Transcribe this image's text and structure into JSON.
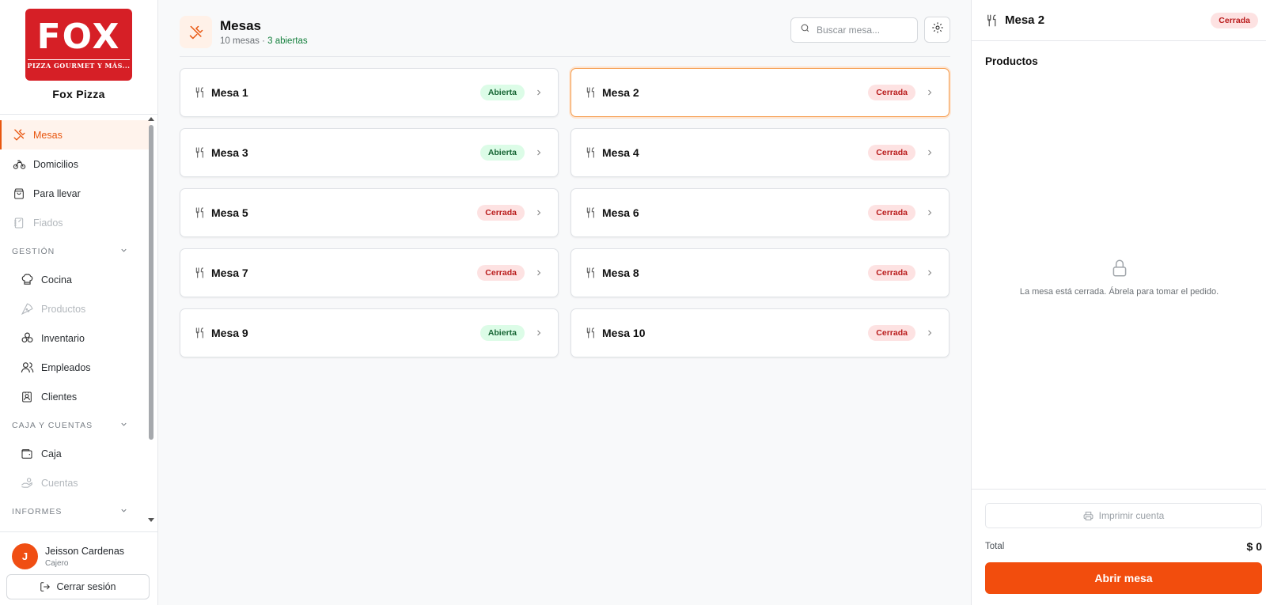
{
  "brand": {
    "logo_main": "FOX",
    "logo_sub": "PIZZA GOURMET Y MÁS...",
    "name": "Fox Pizza"
  },
  "sidebar": {
    "items": [
      {
        "label": "Mesas"
      },
      {
        "label": "Domicilios"
      },
      {
        "label": "Para llevar"
      },
      {
        "label": "Fiados"
      }
    ],
    "sections": [
      {
        "label": "GESTIÓN",
        "items": [
          "Cocina",
          "Productos",
          "Inventario",
          "Empleados",
          "Clientes"
        ]
      },
      {
        "label": "CAJA Y CUENTAS",
        "items": [
          "Caja",
          "Cuentas"
        ]
      },
      {
        "label": "INFORMES"
      }
    ]
  },
  "user": {
    "initial": "J",
    "name": "Jeisson Cardenas",
    "role": "Cajero",
    "logout": "Cerrar sesión"
  },
  "header": {
    "title": "Mesas",
    "count": "10 mesas",
    "separator": "·",
    "open_count": "3 abiertas",
    "search_placeholder": "Buscar mesa..."
  },
  "tables": [
    {
      "name": "Mesa 1",
      "status": "Abierta"
    },
    {
      "name": "Mesa 2",
      "status": "Cerrada"
    },
    {
      "name": "Mesa 3",
      "status": "Abierta"
    },
    {
      "name": "Mesa 4",
      "status": "Cerrada"
    },
    {
      "name": "Mesa 5",
      "status": "Cerrada"
    },
    {
      "name": "Mesa 6",
      "status": "Cerrada"
    },
    {
      "name": "Mesa 7",
      "status": "Cerrada"
    },
    {
      "name": "Mesa 8",
      "status": "Cerrada"
    },
    {
      "name": "Mesa 9",
      "status": "Abierta"
    },
    {
      "name": "Mesa 10",
      "status": "Cerrada"
    }
  ],
  "panel": {
    "title": "Mesa 2",
    "status": "Cerrada",
    "section": "Productos",
    "empty_message": "La mesa está cerrada. Ábrela para tomar el pedido.",
    "print_label": "Imprimir cuenta",
    "total_label": "Total",
    "total_value": "$ 0",
    "open_button": "Abrir mesa"
  },
  "colors": {
    "accent": "#f24d0d",
    "open_badge_bg": "#dcfce7",
    "open_badge_text": "#166534",
    "closed_badge_bg": "#fde2e2",
    "closed_badge_text": "#b91c1c",
    "logo_red": "#d61f26"
  }
}
